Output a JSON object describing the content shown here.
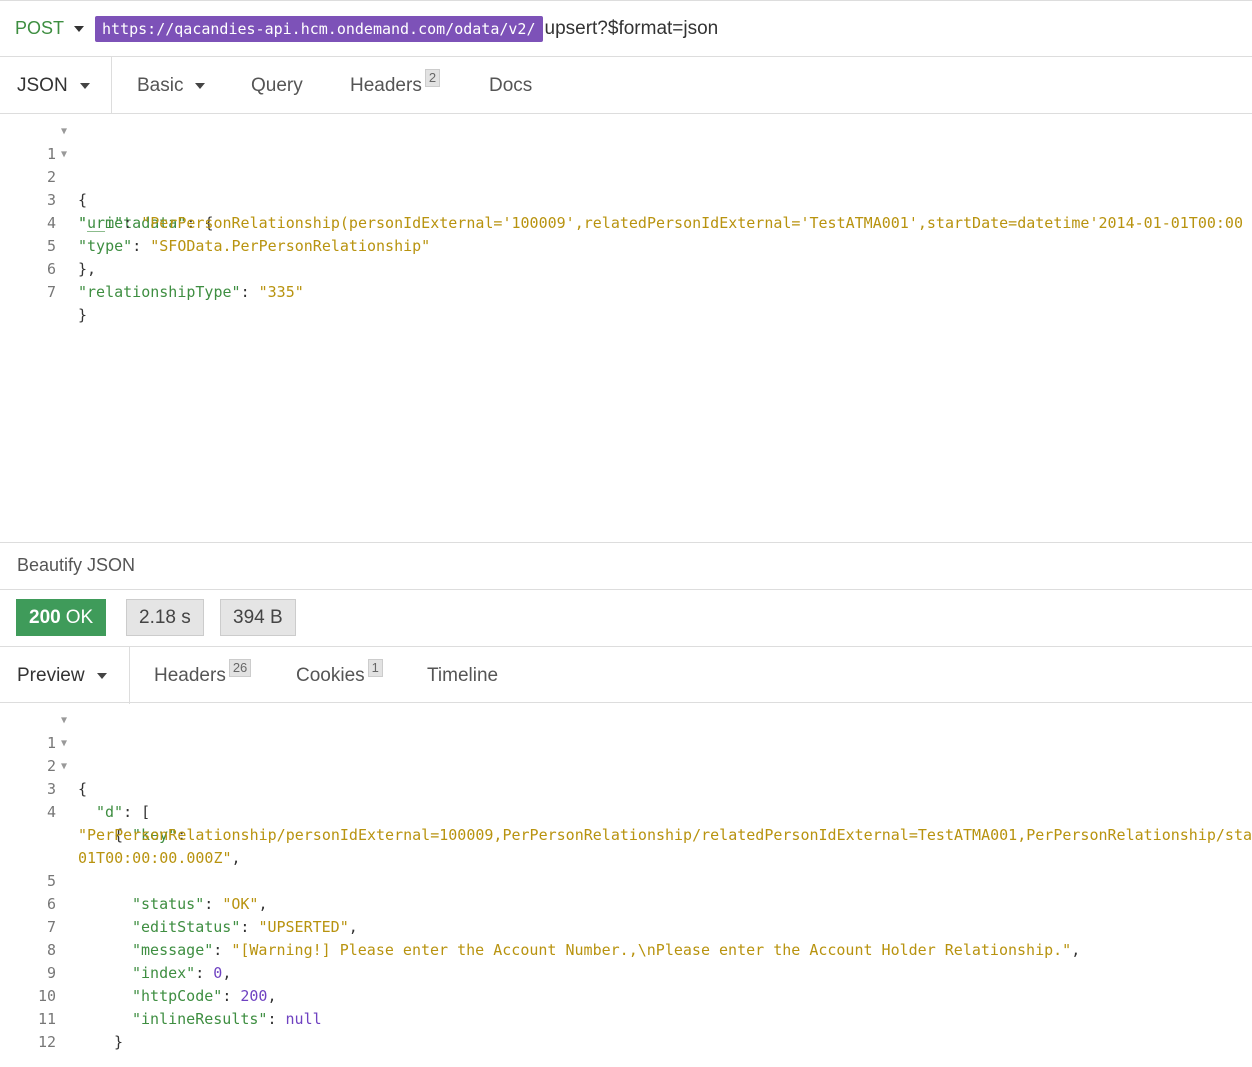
{
  "request": {
    "method": "POST",
    "url_host": "https://qacandies-api.hcm.ondemand.com/odata/v2/",
    "url_rest": "upsert?$format=json",
    "tabs": [
      {
        "label": "JSON"
      },
      {
        "label": "Basic"
      },
      {
        "label": "Query"
      },
      {
        "label": "Headers",
        "badge": "2"
      },
      {
        "label": "Docs"
      }
    ],
    "body_lines": [
      {
        "n": "1",
        "fold": true
      },
      {
        "n": "2",
        "fold": true
      },
      {
        "n": "3"
      },
      {
        "n": "4"
      },
      {
        "n": "5"
      },
      {
        "n": "6"
      },
      {
        "n": "7"
      }
    ],
    "body_text": {
      "l1": "{",
      "l2_key": "\"__metadata\"",
      "l2_rest": ": {",
      "l3_key": "\"uri\"",
      "l3_sep": ": ",
      "l3_val": "\"PerPersonRelationship(personIdExternal='100009',relatedPersonIdExternal='TestATMA001',startDate=datetime'2014-01-01T00:00",
      "l4_key": "\"type\"",
      "l4_sep": ": ",
      "l4_val": "\"SFOData.PerPersonRelationship\"",
      "l5": "},",
      "l6_key": "\"relationshipType\"",
      "l6_sep": ": ",
      "l6_val": "\"335\"",
      "l7": "}"
    },
    "beautify_label": "Beautify JSON"
  },
  "response": {
    "status_code": "200",
    "status_text": "OK",
    "time": "2.18 s",
    "size": "394 B",
    "tabs": [
      {
        "label": "Preview"
      },
      {
        "label": "Headers",
        "badge": "26"
      },
      {
        "label": "Cookies",
        "badge": "1"
      },
      {
        "label": "Timeline"
      }
    ],
    "body_text": {
      "l1": "{",
      "l2_key": "\"d\"",
      "l2_rest": ": [",
      "l3": "{",
      "l4_key": "\"key\"",
      "l4_sep": ":",
      "l4_wrap1": "\"PerPersonRelationship/personIdExternal=100009,PerPersonRelationship/relatedPersonIdExternal=TestATMA001,PerPersonRelationship/sta",
      "l4_wrap2": "01T00:00:00.000Z\"",
      "l4_end": ",",
      "l5_key": "\"status\"",
      "l5_val": "\"OK\"",
      "l6_key": "\"editStatus\"",
      "l6_val": "\"UPSERTED\"",
      "l7_key": "\"message\"",
      "l7_val": "\"[Warning!] Please enter the Account Number.,\\nPlease enter the Account Holder Relationship.\"",
      "l8_key": "\"index\"",
      "l8_val": "0",
      "l9_key": "\"httpCode\"",
      "l9_val": "200",
      "l10_key": "\"inlineResults\"",
      "l10_val": "null",
      "l11": "}",
      "l12": "]",
      "l13": "}",
      "sep": ": ",
      "comma": ","
    }
  },
  "colors": {
    "method": "#3e8e41",
    "url_host_bg": "#7d52b8",
    "status_ok_bg": "#3f9b5a",
    "json_key": "#3e8e41",
    "json_string": "#b8930f",
    "json_number": "#6f42c1"
  },
  "icons": {
    "dropdown": "chevron-down-icon",
    "fold": "fold-arrow-icon"
  }
}
